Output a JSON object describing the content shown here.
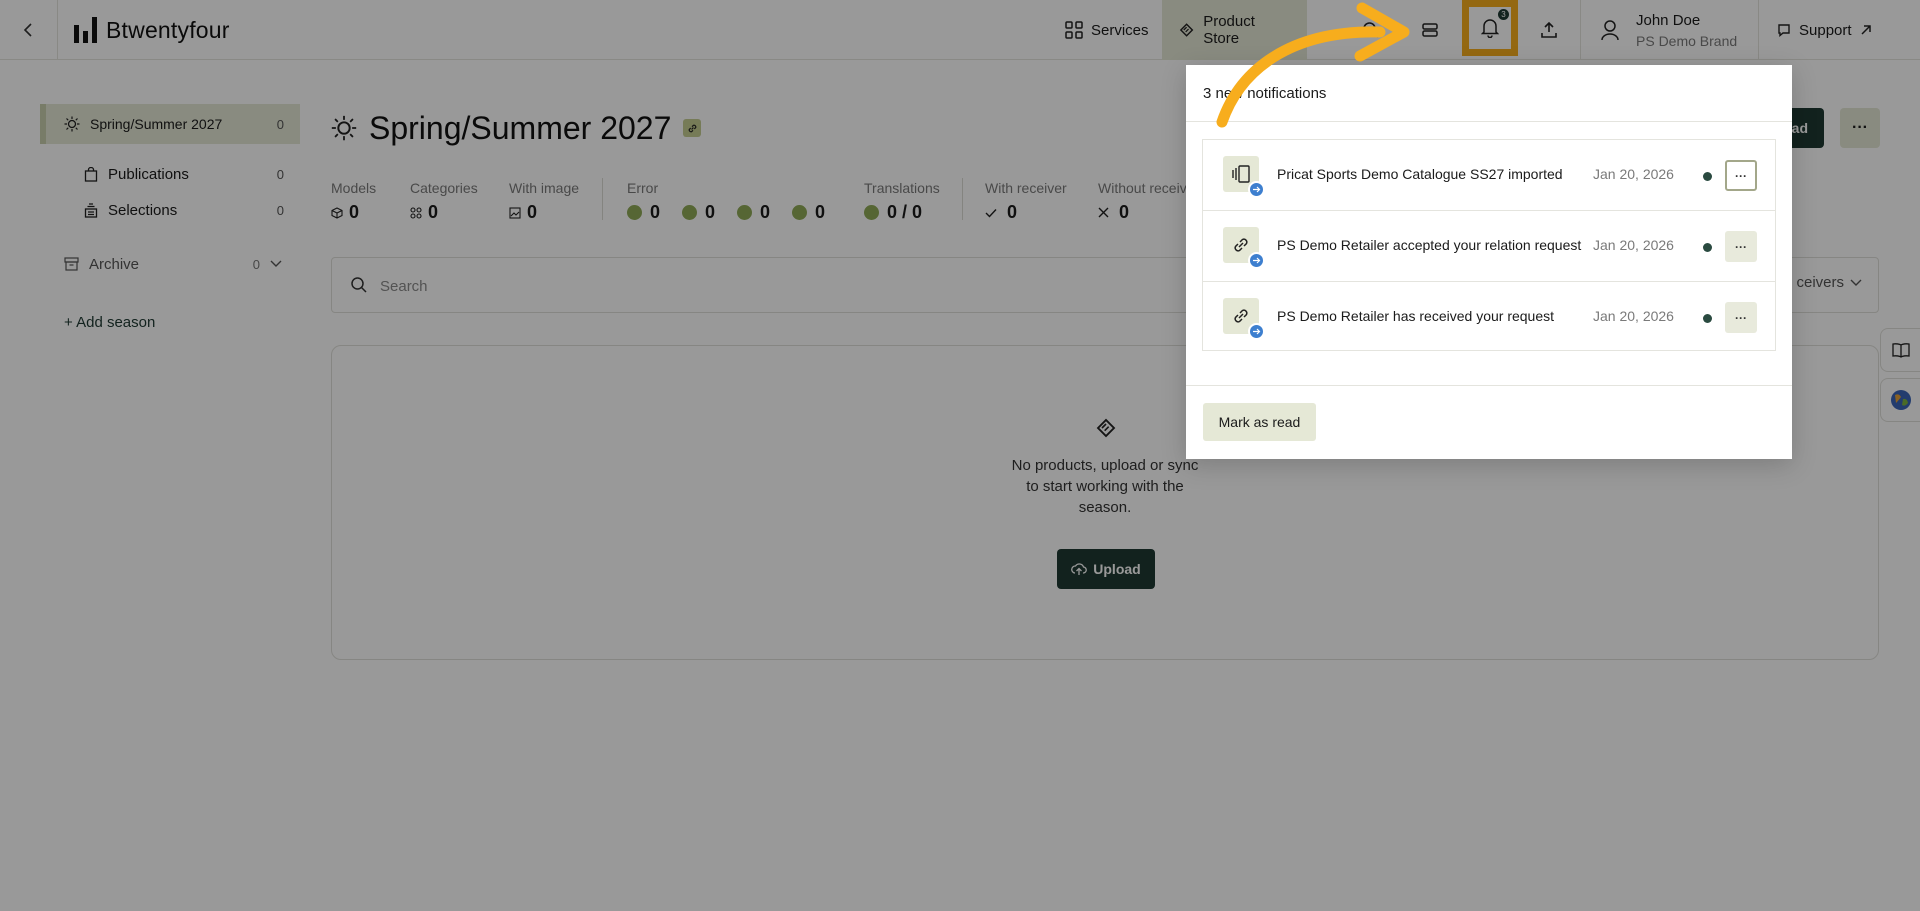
{
  "header": {
    "logo_text": "Btwentyfour",
    "nav": {
      "services": "Services",
      "product_store": "Product Store"
    },
    "notification_badge": "3",
    "user": {
      "name": "John Doe",
      "brand": "PS Demo Brand"
    },
    "support": "Support"
  },
  "sidebar": {
    "season": {
      "label": "Spring/Summer 2027",
      "count": "0"
    },
    "publications": {
      "label": "Publications",
      "count": "0"
    },
    "selections": {
      "label": "Selections",
      "count": "0"
    },
    "archive": {
      "label": "Archive",
      "count": "0"
    },
    "add_season": "+ Add season"
  },
  "main": {
    "title": "Spring/Summer 2027",
    "top_action_label": "ad",
    "more_label": "···",
    "stats": {
      "models": {
        "label": "Models",
        "value": "0"
      },
      "categories": {
        "label": "Categories",
        "value": "0"
      },
      "with_image": {
        "label": "With image",
        "value": "0"
      },
      "error": {
        "label": "Error",
        "values": [
          "0",
          "0",
          "0",
          "0"
        ]
      },
      "translations": {
        "label": "Translations",
        "value": "0 / 0"
      },
      "with_receiver": {
        "label": "With receiver",
        "value": "0"
      },
      "without_receiver": {
        "label": "Without receiv",
        "value": "0"
      }
    },
    "search": {
      "placeholder": "Search",
      "receivers": "ceivers"
    },
    "empty": {
      "message": "No products, upload or sync to start working with the season.",
      "upload_label": "Upload"
    }
  },
  "notifications": {
    "heading": "3 new notifications",
    "items": [
      {
        "text": "Pricat Sports Demo Catalogue SS27 imported",
        "date": "Jan 20, 2026"
      },
      {
        "text": "PS Demo Retailer accepted your relation request",
        "date": "Jan 20, 2026"
      },
      {
        "text": "PS Demo Retailer has received your request",
        "date": "Jan 20, 2026"
      }
    ],
    "more_label": "···",
    "mark_as_read": "Mark as read"
  },
  "colors": {
    "brand_dark": "#1f3a33",
    "accent_light": "#e5e8d6",
    "highlight": "#f7ad1d",
    "unread_dot": "#2a4a40"
  }
}
